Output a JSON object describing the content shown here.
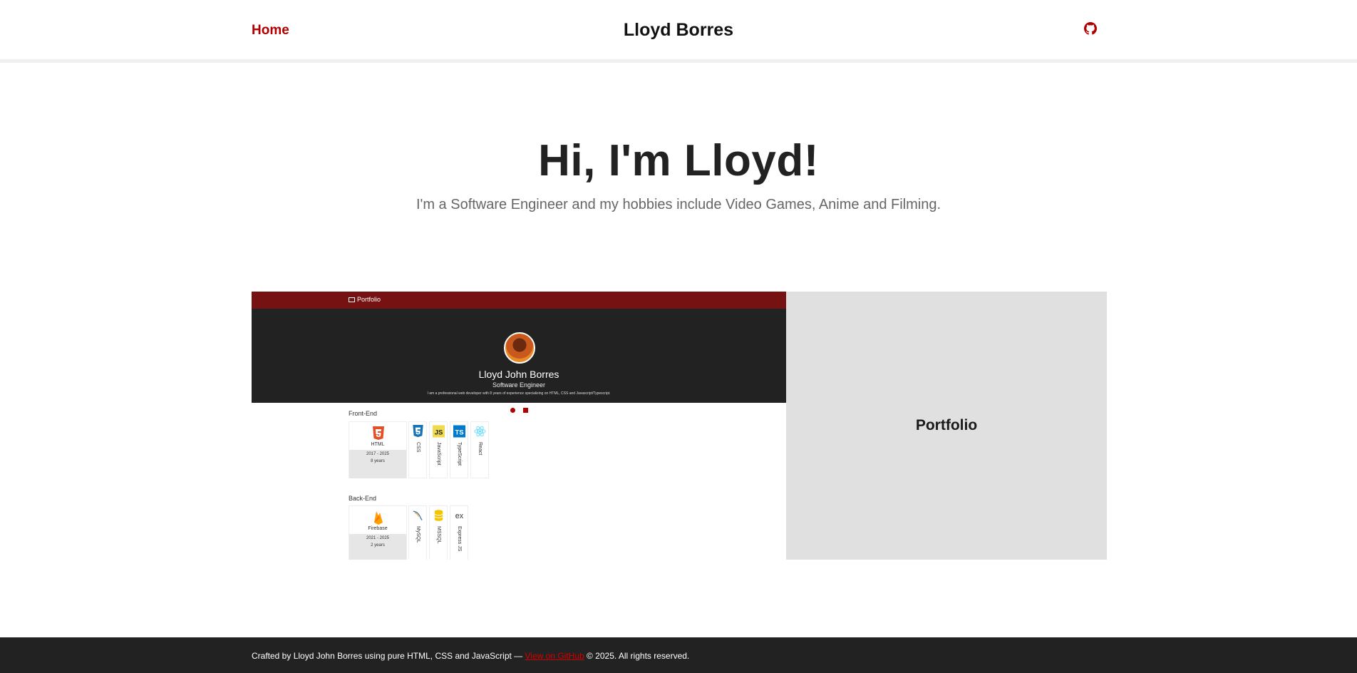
{
  "header": {
    "home_label": "Home",
    "site_title": "Lloyd Borres",
    "github_icon": "github-icon"
  },
  "hero": {
    "title": "Hi, I'm Lloyd!",
    "subtitle": "I'm a Software Engineer and my hobbies include Video Games, Anime and Filming."
  },
  "project": {
    "label": "Portfolio",
    "preview": {
      "bar_title": "Portfolio",
      "name": "Lloyd John Borres",
      "role": "Software Engineer",
      "description": "I am a professional web developer with 8 years of experience specializing on HTML, CSS and Javascript/Typescript.",
      "front_end": {
        "heading": "Front-End",
        "main": {
          "name": "HTML",
          "range": "2017 - 2025",
          "years": "8 years",
          "icon": "html5-icon"
        },
        "others": [
          {
            "name": "CSS",
            "icon": "css3-icon"
          },
          {
            "name": "JavaScript",
            "icon": "javascript-icon"
          },
          {
            "name": "TypeScript",
            "icon": "typescript-icon"
          },
          {
            "name": "React",
            "icon": "react-icon"
          }
        ]
      },
      "back_end": {
        "heading": "Back-End",
        "main": {
          "name": "Firebase",
          "range": "2021 - 2025",
          "years": "2 years",
          "icon": "firebase-icon"
        },
        "others": [
          {
            "name": "MySQL",
            "icon": "mysql-icon"
          },
          {
            "name": "MSSQL",
            "icon": "database-icon"
          },
          {
            "name": "Express JS",
            "icon": "express-icon"
          }
        ]
      }
    }
  },
  "footer": {
    "text_before": "Crafted by Lloyd John Borres using pure HTML, CSS and JavaScript — ",
    "link_label": "View on GitHub",
    "text_after": " © 2025. All rights reserved."
  },
  "colors": {
    "accent": "#b00000",
    "preview_bar": "#761212",
    "preview_hero": "#222222",
    "footer_bg": "#222222",
    "card_label_bg": "#e0e0e0"
  }
}
